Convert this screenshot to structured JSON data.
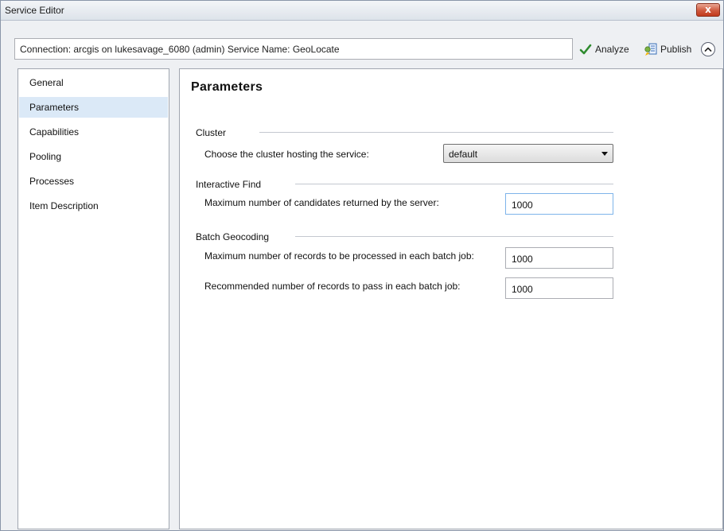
{
  "window": {
    "title": "Service Editor",
    "close_glyph": "x"
  },
  "toolbar": {
    "connection_text": "Connection: arcgis on lukesavage_6080 (admin)   Service Name: GeoLocate",
    "analyze_label": "Analyze",
    "publish_label": "Publish",
    "analyze_icon": "checkmark-icon",
    "publish_icon": "publish-icon",
    "collapse_icon": "chevron-up-icon"
  },
  "sidebar": {
    "items": [
      {
        "label": "General"
      },
      {
        "label": "Parameters",
        "selected": true
      },
      {
        "label": "Capabilities"
      },
      {
        "label": "Pooling"
      },
      {
        "label": "Processes"
      },
      {
        "label": "Item Description"
      }
    ]
  },
  "main": {
    "title": "Parameters",
    "sections": [
      {
        "label": "Cluster",
        "fields": [
          {
            "label": "Choose the cluster hosting the service:",
            "value": "default",
            "type": "select"
          }
        ]
      },
      {
        "label": "Interactive Find",
        "fields": [
          {
            "label": "Maximum number of candidates returned by the server:",
            "value": "1000",
            "type": "text"
          }
        ]
      },
      {
        "label": "Batch Geocoding",
        "fields": [
          {
            "label": "Maximum number of records to be processed in each batch job:",
            "value": "1000",
            "type": "text"
          },
          {
            "label": "Recommended number of records to pass in each batch job:",
            "value": "1000",
            "type": "text"
          }
        ]
      }
    ]
  },
  "colors": {
    "selected_item_bg": "#dbe9f7",
    "close_button": "#c23a1c",
    "check_green": "#2e8b2e"
  }
}
